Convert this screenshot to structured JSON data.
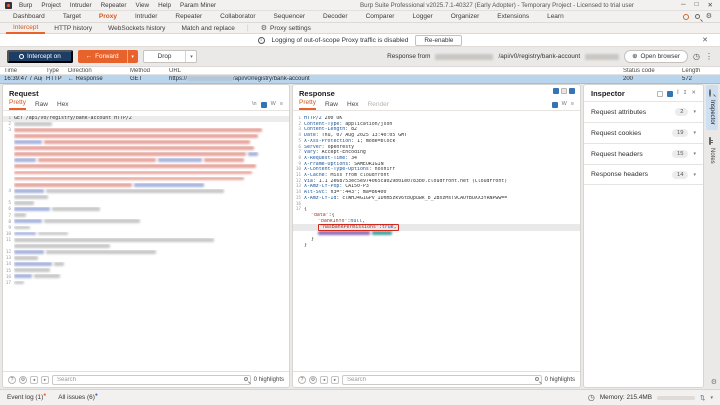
{
  "window": {
    "title": "Burp Suite Professional v2025.7.1-40327 (Early Adopter) - Temporary Project - Licensed to trial user",
    "menu": [
      "Burp",
      "Project",
      "Intruder",
      "Repeater",
      "View",
      "Help",
      "Param Miner"
    ]
  },
  "main_tabs": {
    "items": [
      "Dashboard",
      "Target",
      "Proxy",
      "Intruder",
      "Repeater",
      "Collaborator",
      "Sequencer",
      "Decoder",
      "Comparer",
      "Logger",
      "Organizer",
      "Extensions",
      "Learn"
    ],
    "active": "Proxy"
  },
  "sub_tabs": {
    "items": [
      "Intercept",
      "HTTP history",
      "WebSockets history",
      "Match and replace",
      "Proxy settings"
    ],
    "active": "Intercept"
  },
  "notification": {
    "message": "Logging of out-of-scope Proxy traffic is disabled",
    "button": "Re-enable"
  },
  "intercept_toolbar": {
    "intercept_button": "Intercept on",
    "forward_button": "Forward",
    "drop_button": "Drop",
    "forward_arrow": "←",
    "response_from_label": "Response from",
    "response_path": "/api/v0/registry/bank-account",
    "open_browser_button": "Open browser"
  },
  "history_table": {
    "columns": [
      "Time",
      "Type",
      "Direction",
      "Method",
      "URL",
      "Status code",
      "Length"
    ],
    "row": {
      "time": "16:39:47 7 Aug 2...",
      "type": "HTTP",
      "direction_arrow": "←",
      "direction": "Response",
      "method": "GET",
      "url_scheme": "https://",
      "url_path": "/api/v0/registry/bank-account",
      "status_code": "200",
      "length": "572"
    }
  },
  "request_panel": {
    "title": "Request",
    "tabs": [
      "Pretty",
      "Raw",
      "Hex"
    ],
    "active_tab": "Pretty",
    "first_line": "GET /api/v0/registry/bank-account HTTP/2"
  },
  "response_panel": {
    "title": "Response",
    "tabs": [
      "Pretty",
      "Raw",
      "Hex",
      "Render"
    ],
    "active_tab": "Pretty",
    "disabled_tab": "Render",
    "headers": [
      {
        "n": "1",
        "name": "HTTP/2",
        "value": "200 OK",
        "status_line": true
      },
      {
        "n": "2",
        "name": "Content-Type",
        "value": "application/json"
      },
      {
        "n": "3",
        "name": "Content-Length",
        "value": "82"
      },
      {
        "n": "4",
        "name": "Date",
        "value": "Thu, 07 Aug 2025 13:40:05 GMT"
      },
      {
        "n": "5",
        "name": "X-Xss-Protection",
        "value": "1; mode=block"
      },
      {
        "n": "6",
        "name": "Server",
        "value": "openresty"
      },
      {
        "n": "7",
        "name": "Vary",
        "value": "Accept-Encoding"
      },
      {
        "n": "8",
        "name": "X-Request-Time",
        "value": "34"
      },
      {
        "n": "9",
        "name": "X-Frame-Options",
        "value": "SAMEORIGIN"
      },
      {
        "n": "10",
        "name": "X-Content-Type-Options",
        "value": "nosniff"
      },
      {
        "n": "11",
        "name": "X-Cache",
        "value": "Miss from cloudfront"
      },
      {
        "n": "12",
        "name": "Via",
        "value": "1.1 2e68753ec5e974065ca029b01e0783b0.cloudfront.net (CloudFront)"
      },
      {
        "n": "13",
        "name": "X-Amz-Cf-Pop",
        "value": "CAI50-P3"
      },
      {
        "n": "14",
        "name": "Alt-Svc",
        "value": "h3=\":443\"; ma=86400"
      },
      {
        "n": "15",
        "name": "X-Amz-Cf-Id",
        "value": "clWHJ4G1GPv_IDnm5zkv6tbQpuwk_b_2BxzMsT9CAOfBUXX3YRNPww=="
      },
      {
        "n": "16",
        "name": "",
        "value": "",
        "blank": true
      }
    ],
    "body": [
      {
        "n": "17",
        "indent": 0,
        "segments": [
          {
            "text": "{",
            "type": "punct"
          }
        ]
      },
      {
        "indent": 1,
        "segments": [
          {
            "text": "\"data\"",
            "type": "key"
          },
          {
            "text": ":{",
            "type": "punct"
          }
        ]
      },
      {
        "indent": 2,
        "segments": [
          {
            "text": "\"bankInfo\"",
            "type": "key"
          },
          {
            "text": ":",
            "type": "punct"
          },
          {
            "text": "null",
            "type": "literal"
          },
          {
            "text": ",",
            "type": "punct"
          }
        ]
      },
      {
        "indent": 2,
        "highlight": true,
        "segments": [
          {
            "text": "\"hasBankPermissions\"",
            "type": "key"
          },
          {
            "text": ":",
            "type": "punct"
          },
          {
            "text": "true",
            "type": "literal"
          },
          {
            "text": ",",
            "type": "punct"
          }
        ]
      },
      {
        "indent": 2,
        "redacted": true,
        "segments": []
      },
      {
        "indent": 1,
        "segments": [
          {
            "text": "}",
            "type": "punct"
          }
        ]
      },
      {
        "indent": 0,
        "segments": [
          {
            "text": "}",
            "type": "punct"
          }
        ]
      }
    ]
  },
  "inspector": {
    "title": "Inspector",
    "sections": [
      {
        "label": "Request attributes",
        "count": "2"
      },
      {
        "label": "Request cookies",
        "count": "19"
      },
      {
        "label": "Request headers",
        "count": "15"
      },
      {
        "label": "Response headers",
        "count": "14"
      }
    ],
    "side_tabs": [
      "Inspector",
      "Notes"
    ],
    "active_side_tab": "Inspector"
  },
  "search": {
    "placeholder": "Search",
    "highlights_label": "0 highlights"
  },
  "status_bar": {
    "event_log": "Event log (1)",
    "all_issues": "All issues (6)",
    "memory": "Memory: 215.4MB"
  },
  "colors": {
    "accent_orange": "#e8622c",
    "intercept_navy": "#1c3e66",
    "selection_blue": "#b9d5ee",
    "highlight_red": "#d1281d"
  }
}
